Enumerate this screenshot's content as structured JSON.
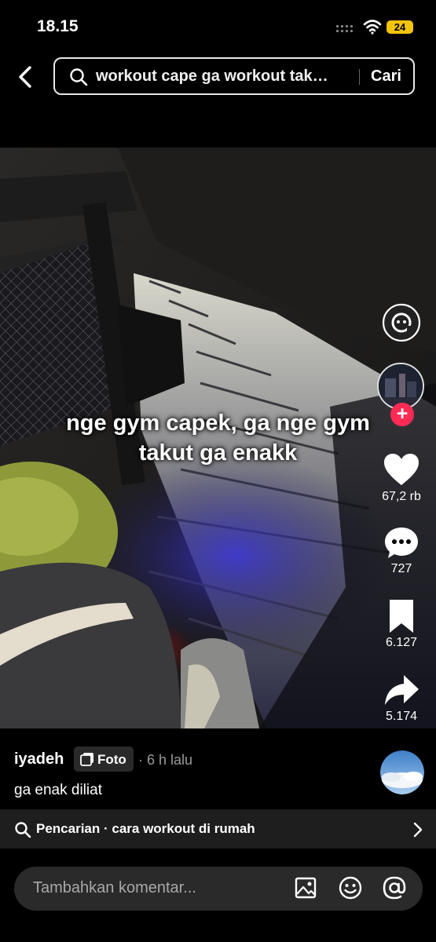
{
  "status_bar": {
    "time": "18.15",
    "battery": "24"
  },
  "search": {
    "query": "workout cape ga workout tak…",
    "button_label": "Cari"
  },
  "post": {
    "overlay_text": "nge gym capek, ga nge gym takut ga enakk",
    "likes": "67,2 rb",
    "comments": "727",
    "saves": "6.127",
    "shares": "5.174",
    "username": "iyadeh",
    "type_badge": "Foto",
    "time_ago": "· 6 h lalu",
    "description": "ga enak diliat"
  },
  "related_search": {
    "text": "Pencarian · cara workout di rumah"
  },
  "comment": {
    "placeholder": "Tambahkan komentar..."
  },
  "colors": {
    "follow_plus": "#ff2b55",
    "battery": "#f2c40d",
    "background": "#000000"
  }
}
